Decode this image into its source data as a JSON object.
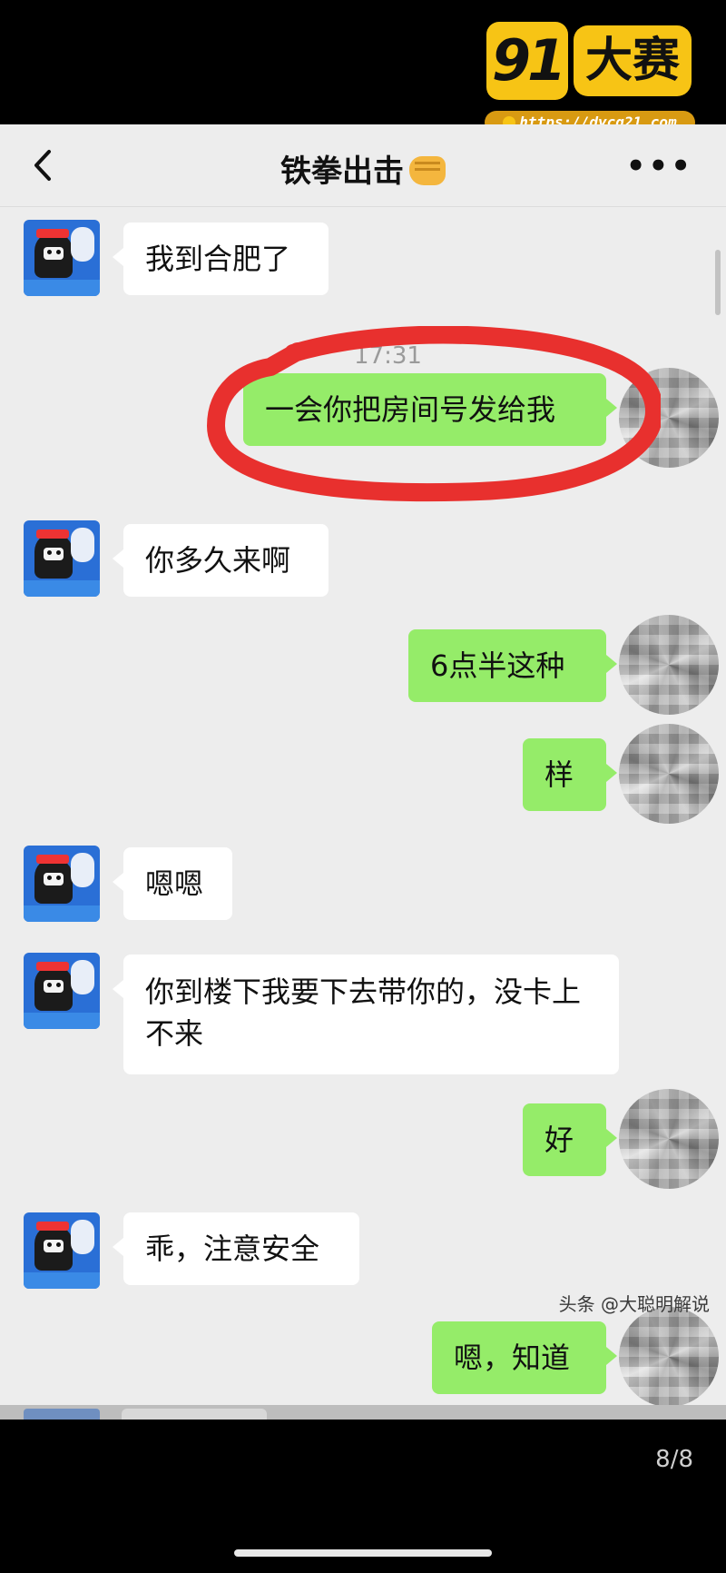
{
  "overlay": {
    "logo_number": "91",
    "logo_name": "大赛",
    "url": "https://dycg21.com",
    "watermark": "头条 @大聪明解说",
    "pager": "8/8"
  },
  "chat": {
    "title": "铁拳出击",
    "title_emoji": "fist-emoji",
    "timestamp": "17:31",
    "highlight_color": "#e8302e",
    "messages": [
      {
        "side": "left",
        "text": "我到合肥了"
      },
      {
        "side": "right",
        "text": "一会你把房间号发给我"
      },
      {
        "side": "left",
        "text": "你多久来啊"
      },
      {
        "side": "right",
        "text": "6点半这种"
      },
      {
        "side": "right",
        "text": "样"
      },
      {
        "side": "left",
        "text": "嗯嗯"
      },
      {
        "side": "left",
        "text": "你到楼下我要下去带你的，没卡上不来"
      },
      {
        "side": "right",
        "text": "好"
      },
      {
        "side": "left",
        "text": "乖，注意安全"
      },
      {
        "side": "right",
        "text": "嗯，知道"
      }
    ]
  },
  "colors": {
    "chat_bg": "#ededed",
    "right_bubble": "#95ec69",
    "left_bubble": "#ffffff",
    "logo_yellow": "#f7c415"
  }
}
